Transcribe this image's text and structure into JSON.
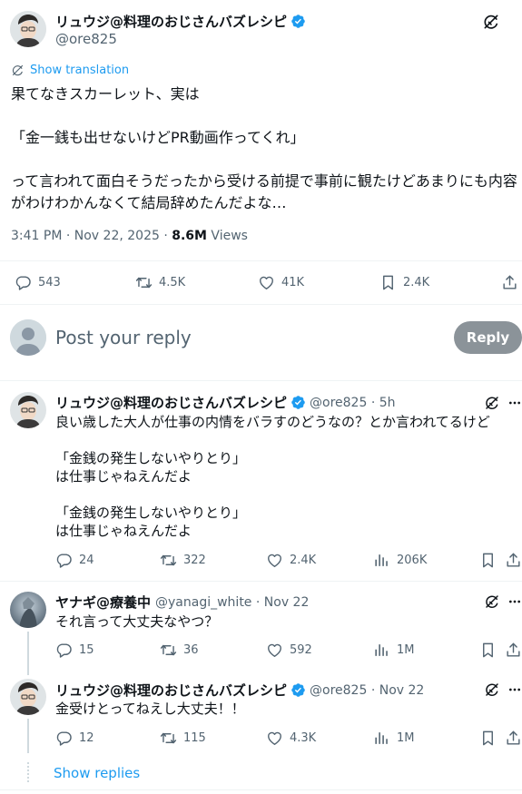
{
  "main_tweet": {
    "author_name": "リュウジ@料理のおじさんバズレシピ",
    "handle": "@ore825",
    "show_translation": "Show translation",
    "text": "果てなきスカーレット、実は\n\n「金一銭も出せないけどPR動画作ってくれ」\n\nって言われて面白そうだったから受ける前提で事前に観たけどあまりにも内容がわけわかんなくて結局辞めたんだよな…",
    "timestamp": "3:41 PM · Nov 22, 2025 · ",
    "views_count": "8.6M",
    "views_label": " Views",
    "replies": "543",
    "reposts": "4.5K",
    "likes": "41K",
    "bookmarks": "2.4K"
  },
  "reply_box": {
    "placeholder": "Post your reply",
    "button_label": "Reply"
  },
  "replies": [
    {
      "author_name": "リュウジ@料理のおじさんバズレシピ",
      "handle_time": "@ore825 · 5h",
      "text": "良い歳した大人が仕事の内情をバラすのどうなの？とか言われてるけど\n\n「金銭の発生しないやりとり」\nは仕事じゃねえんだよ\n\n「金銭の発生しないやりとり」\nは仕事じゃねえんだよ",
      "replies": "24",
      "reposts": "322",
      "likes": "2.4K",
      "views": "206K"
    },
    {
      "author_name": "ヤナギ@療養中",
      "handle_time": "@yanagi_white · Nov 22",
      "text": "それ言って大丈夫なやつ？",
      "replies": "15",
      "reposts": "36",
      "likes": "592",
      "views": "1M"
    },
    {
      "author_name": "リュウジ@料理のおじさんバズレシピ",
      "handle_time": "@ore825 · Nov 22",
      "text": "金受けとってねえし大丈夫！！",
      "replies": "12",
      "reposts": "115",
      "likes": "4.3K",
      "views": "1M"
    }
  ],
  "show_replies": "Show replies",
  "colors": {
    "accent": "#1d9bf0",
    "muted": "#536471",
    "reply_button": "#8b9399",
    "verified": "#1d9bf0"
  }
}
